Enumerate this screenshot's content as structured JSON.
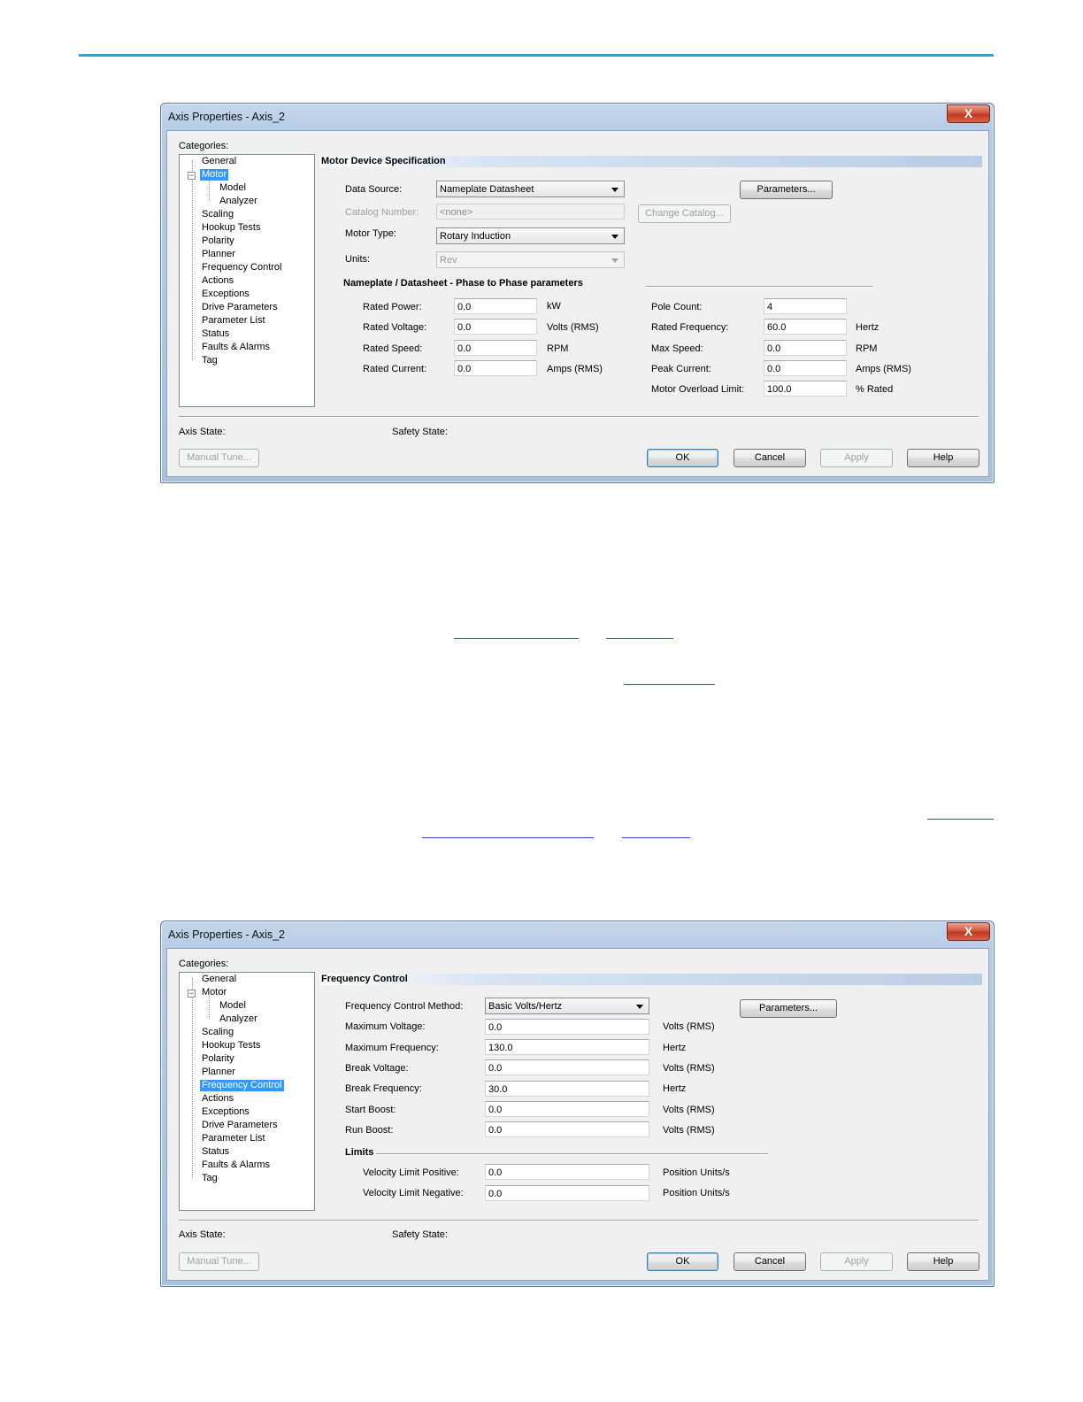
{
  "dialog1": {
    "title": "Axis Properties - Axis_2",
    "close": "X",
    "categories_label": "Categories:",
    "tree": [
      {
        "label": "General",
        "selected": false
      },
      {
        "label": "Motor",
        "selected": true
      },
      {
        "label": "Model",
        "selected": false
      },
      {
        "label": "Analyzer",
        "selected": false
      },
      {
        "label": "Scaling",
        "selected": false
      },
      {
        "label": "Hookup Tests",
        "selected": false
      },
      {
        "label": "Polarity",
        "selected": false
      },
      {
        "label": "Planner",
        "selected": false
      },
      {
        "label": "Frequency Control",
        "selected": false
      },
      {
        "label": "Actions",
        "selected": false
      },
      {
        "label": "Exceptions",
        "selected": false
      },
      {
        "label": "Drive Parameters",
        "selected": false
      },
      {
        "label": "Parameter List",
        "selected": false
      },
      {
        "label": "Status",
        "selected": false
      },
      {
        "label": "Faults & Alarms",
        "selected": false
      },
      {
        "label": "Tag",
        "selected": false
      }
    ],
    "section_title": "Motor Device Specification",
    "data_source_label": "Data Source:",
    "data_source_value": "Nameplate Datasheet",
    "parameters_btn": "Parameters...",
    "catalog_label": "Catalog Number:",
    "catalog_value": "<none>",
    "change_catalog_btn": "Change Catalog...",
    "motor_type_label": "Motor Type:",
    "motor_type_value": "Rotary Induction",
    "units_label": "Units:",
    "units_value": "Rev",
    "nameplate_header": "Nameplate / Datasheet - Phase to Phase parameters",
    "left_params": [
      {
        "label": "Rated Power:",
        "value": "0.0",
        "unit": "kW"
      },
      {
        "label": "Rated Voltage:",
        "value": "0.0",
        "unit": "Volts (RMS)"
      },
      {
        "label": "Rated Speed:",
        "value": "0.0",
        "unit": "RPM"
      },
      {
        "label": "Rated Current:",
        "value": "0.0",
        "unit": "Amps (RMS)"
      }
    ],
    "right_params": [
      {
        "label": "Pole Count:",
        "value": "4",
        "unit": ""
      },
      {
        "label": "Rated Frequency:",
        "value": "60.0",
        "unit": "Hertz"
      },
      {
        "label": "Max Speed:",
        "value": "0.0",
        "unit": "RPM"
      },
      {
        "label": "Peak Current:",
        "value": "0.0",
        "unit": "Amps (RMS)"
      },
      {
        "label": "Motor Overload Limit:",
        "value": "100.0",
        "unit": "% Rated"
      }
    ],
    "axis_state_label": "Axis State:",
    "safety_state_label": "Safety State:",
    "manual_tune_btn": "Manual Tune...",
    "ok_btn": "OK",
    "cancel_btn": "Cancel",
    "apply_btn": "Apply",
    "help_btn": "Help"
  },
  "dialog2": {
    "title": "Axis Properties - Axis_2",
    "close": "X",
    "categories_label": "Categories:",
    "tree": [
      {
        "label": "General",
        "selected": false
      },
      {
        "label": "Motor",
        "selected": false
      },
      {
        "label": "Model",
        "selected": false
      },
      {
        "label": "Analyzer",
        "selected": false
      },
      {
        "label": "Scaling",
        "selected": false
      },
      {
        "label": "Hookup Tests",
        "selected": false
      },
      {
        "label": "Polarity",
        "selected": false
      },
      {
        "label": "Planner",
        "selected": false
      },
      {
        "label": "Frequency Control",
        "selected": true
      },
      {
        "label": "Actions",
        "selected": false
      },
      {
        "label": "Exceptions",
        "selected": false
      },
      {
        "label": "Drive Parameters",
        "selected": false
      },
      {
        "label": "Parameter List",
        "selected": false
      },
      {
        "label": "Status",
        "selected": false
      },
      {
        "label": "Faults & Alarms",
        "selected": false
      },
      {
        "label": "Tag",
        "selected": false
      }
    ],
    "section_title": "Frequency Control",
    "method_label": "Frequency Control Method:",
    "method_value": "Basic Volts/Hertz",
    "parameters_btn": "Parameters...",
    "params": [
      {
        "label": "Maximum Voltage:",
        "value": "0.0",
        "unit": "Volts (RMS)"
      },
      {
        "label": "Maximum Frequency:",
        "value": "130.0",
        "unit": "Hertz"
      },
      {
        "label": "Break Voltage:",
        "value": "0.0",
        "unit": "Volts (RMS)"
      },
      {
        "label": "Break Frequency:",
        "value": "30.0",
        "unit": "Hertz"
      },
      {
        "label": "Start Boost:",
        "value": "0.0",
        "unit": "Volts (RMS)"
      },
      {
        "label": "Run Boost:",
        "value": "0.0",
        "unit": "Volts (RMS)"
      }
    ],
    "limits_header": "Limits",
    "limits": [
      {
        "label": "Velocity Limit Positive:",
        "value": "0.0",
        "unit": "Position Units/s"
      },
      {
        "label": "Velocity Limit Negative:",
        "value": "0.0",
        "unit": "Position Units/s"
      }
    ],
    "axis_state_label": "Axis State:",
    "safety_state_label": "Safety State:",
    "manual_tune_btn": "Manual Tune...",
    "ok_btn": "OK",
    "cancel_btn": "Cancel",
    "apply_btn": "Apply",
    "help_btn": "Help"
  },
  "colors": {
    "accent_rule": "#2aa7e0",
    "tree_selection": "#3399ff",
    "link": "#2a4dd0"
  }
}
